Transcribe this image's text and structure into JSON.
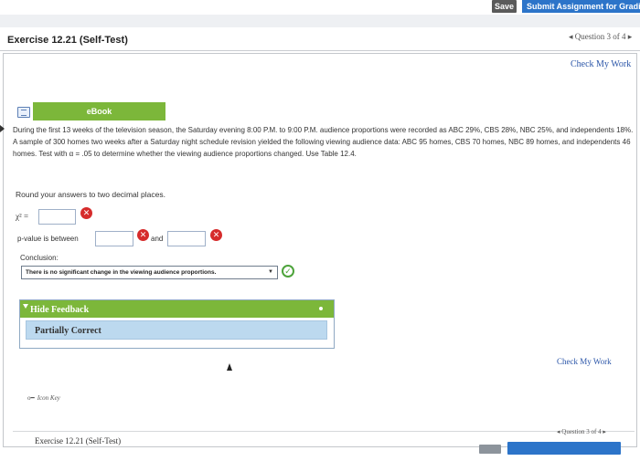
{
  "topbar": {
    "save_label": "Save",
    "submit_label": "Submit Assignment for Grading"
  },
  "header": {
    "exercise_title": "Exercise 12.21 (Self-Test)",
    "question_nav": "◂ Question 3 of 4 ▸"
  },
  "actions": {
    "check_my_work": "Check My Work",
    "ebook_label": "eBook"
  },
  "problem": {
    "text": "During the first 13 weeks of the television season, the Saturday evening 8:00 P.M. to 9:00 P.M. audience proportions were recorded as ABC 29%, CBS 28%, NBC 25%, and independents 18%. A sample of 300 homes two weeks after a Saturday night schedule revision yielded the following viewing audience data: ABC 95 homes, CBS 70 homes, NBC 89 homes, and independents 46 homes. Test with α = .05 to determine whether the viewing audience proportions changed. Use Table 12.4.",
    "round_note": "Round your answers to two decimal places.",
    "chi_label": "χ² =",
    "chi_value": "",
    "pvalue_label": "p-value is between",
    "pvalue_low": "",
    "and_label": "and",
    "pvalue_high": "",
    "conclusion_label": "Conclusion:",
    "conclusion_selected": "There is no significant change in the viewing audience proportions."
  },
  "feedback": {
    "title": "Hide Feedback",
    "result": "Partially Correct"
  },
  "icon_key": {
    "label": "Icon Key"
  },
  "footer": {
    "exercise_title": "Exercise 12.21 (Self-Test)",
    "question_nav": "◂ Question 3 of 4 ▸"
  },
  "colors": {
    "accent_green": "#7cb73a",
    "accent_blue": "#2c74c9",
    "error_red": "#d62b2b",
    "success_green": "#4da33b",
    "result_bg": "#bcd9ef"
  },
  "icons": {
    "incorrect": "x-circle-icon",
    "correct": "check-circle-icon",
    "ebook": "book-icon",
    "key": "key-icon"
  }
}
